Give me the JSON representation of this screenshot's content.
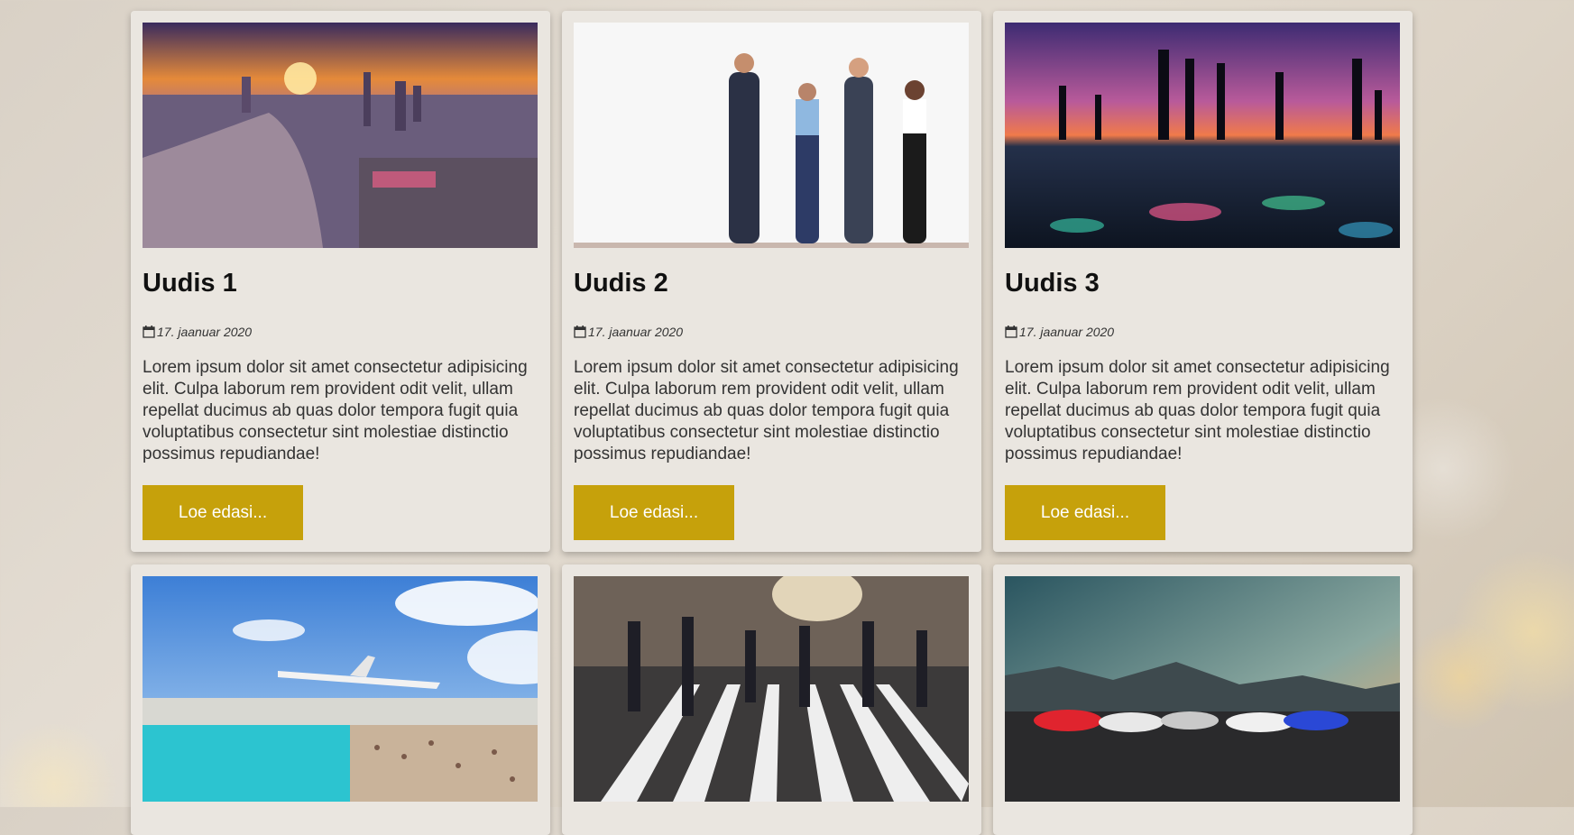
{
  "cards": [
    {
      "title": "Uudis 1",
      "date": "17. jaanuar 2020",
      "excerpt": "Lorem ipsum dolor sit amet consectetur adipisicing elit. Culpa laborum rem provident odit velit, ullam repellat ducimus ab quas dolor tempora fugit quia voluptatibus consectetur sint molestiae distinctio possimus repudiandae!",
      "button": "Loe edasi..."
    },
    {
      "title": "Uudis 2",
      "date": "17. jaanuar 2020",
      "excerpt": "Lorem ipsum dolor sit amet consectetur adipisicing elit. Culpa laborum rem provident odit velit, ullam repellat ducimus ab quas dolor tempora fugit quia voluptatibus consectetur sint molestiae distinctio possimus repudiandae!",
      "button": "Loe edasi..."
    },
    {
      "title": "Uudis 3",
      "date": "17. jaanuar 2020",
      "excerpt": "Lorem ipsum dolor sit amet consectetur adipisicing elit. Culpa laborum rem provident odit velit, ullam repellat ducimus ab quas dolor tempora fugit quia voluptatibus consectetur sint molestiae distinctio possimus repudiandae!",
      "button": "Loe edasi..."
    }
  ],
  "icons": {
    "date": "calendar-icon"
  },
  "colors": {
    "button": "#c6a10b",
    "card": "#eae6e0"
  }
}
